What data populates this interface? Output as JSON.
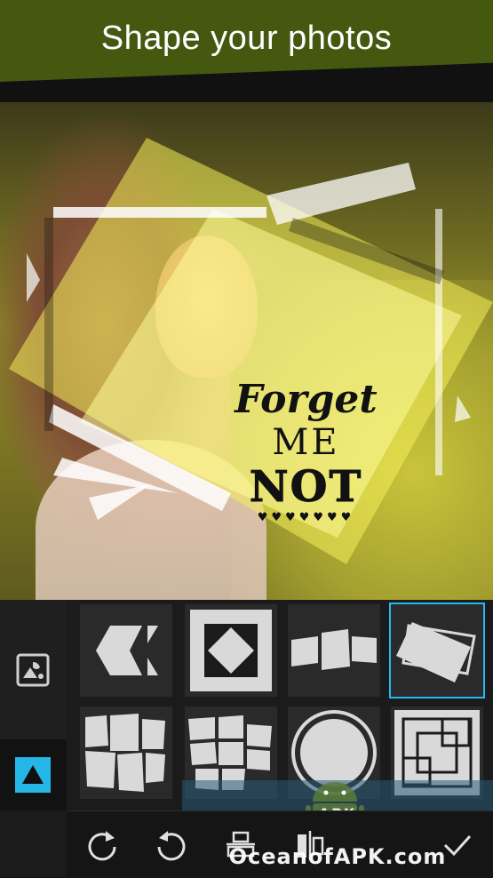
{
  "header": {
    "title": "Shape your photos"
  },
  "photo": {
    "poster_lines": {
      "line1": "Forget",
      "line2": "ME",
      "line3": "NOT"
    },
    "poster_dots": "♥♥♥♥♥♥♥"
  },
  "sidebar": {
    "items": [
      {
        "icon": "photo-fill-icon"
      },
      {
        "icon": "triangle-shape-icon",
        "active": true
      }
    ]
  },
  "shapes": {
    "items": [
      {
        "name": "hexagon-split"
      },
      {
        "name": "diamond-in-square"
      },
      {
        "name": "offset-rectangles"
      },
      {
        "name": "tilted-stacked-frames",
        "selected": true
      },
      {
        "name": "grid-collage-3"
      },
      {
        "name": "grid-collage-6"
      },
      {
        "name": "circle-ring"
      },
      {
        "name": "double-square-corners"
      }
    ]
  },
  "toolbar": {
    "items": [
      {
        "icon": "rotate-cw-icon"
      },
      {
        "icon": "rotate-ccw-icon"
      },
      {
        "icon": "align-horizontal-icon"
      },
      {
        "icon": "align-vertical-icon"
      },
      {
        "icon": "check-icon"
      }
    ]
  },
  "watermark": {
    "text": "OceanofAPK.com",
    "badge": "APK"
  },
  "colors": {
    "header": "#44590f",
    "accent": "#27b8f0"
  }
}
